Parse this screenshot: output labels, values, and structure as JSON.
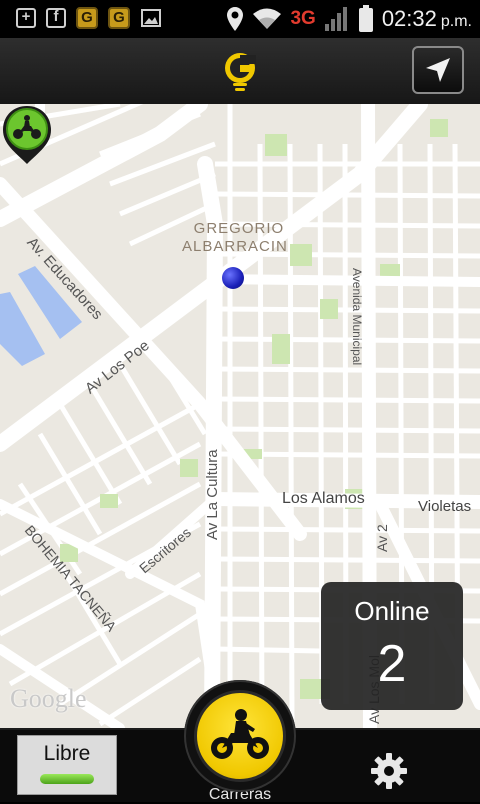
{
  "status_bar": {
    "network": "3G",
    "time": "02:32",
    "ampm": "p.m."
  },
  "header": {
    "logo_icon": "g-logo-icon",
    "nav_icon": "navigation-arrow-icon"
  },
  "map": {
    "labels": {
      "neighborhood_line1": "GREGORIO",
      "neighborhood_line2": "ALBARRACIN",
      "av_educadores": "Av. Educadores",
      "av_los_poetas": "Av Los Poe",
      "av_la_cultura": "Av La Cultura",
      "avenida_municipal": "Avenida Municipal",
      "los_alamos": "Los Alamos",
      "violetas": "Violetas",
      "av_2": "Av 2",
      "escritores": "Escritores",
      "bohemia_tacnena": "BOHEMIA TACNEÑA",
      "av_los_molles": "Av Los Mol"
    },
    "attribution": "Google"
  },
  "online_card": {
    "label": "Online",
    "count": "2"
  },
  "bottom_bar": {
    "libre_label": "Libre",
    "carreras_label": "Carreras",
    "settings_icon": "gear-icon"
  },
  "colors": {
    "accent_yellow": "#f0c800",
    "status_green": "#6cc62e",
    "network_red": "#e23b2e",
    "location_blue": "#1a1fb8"
  }
}
